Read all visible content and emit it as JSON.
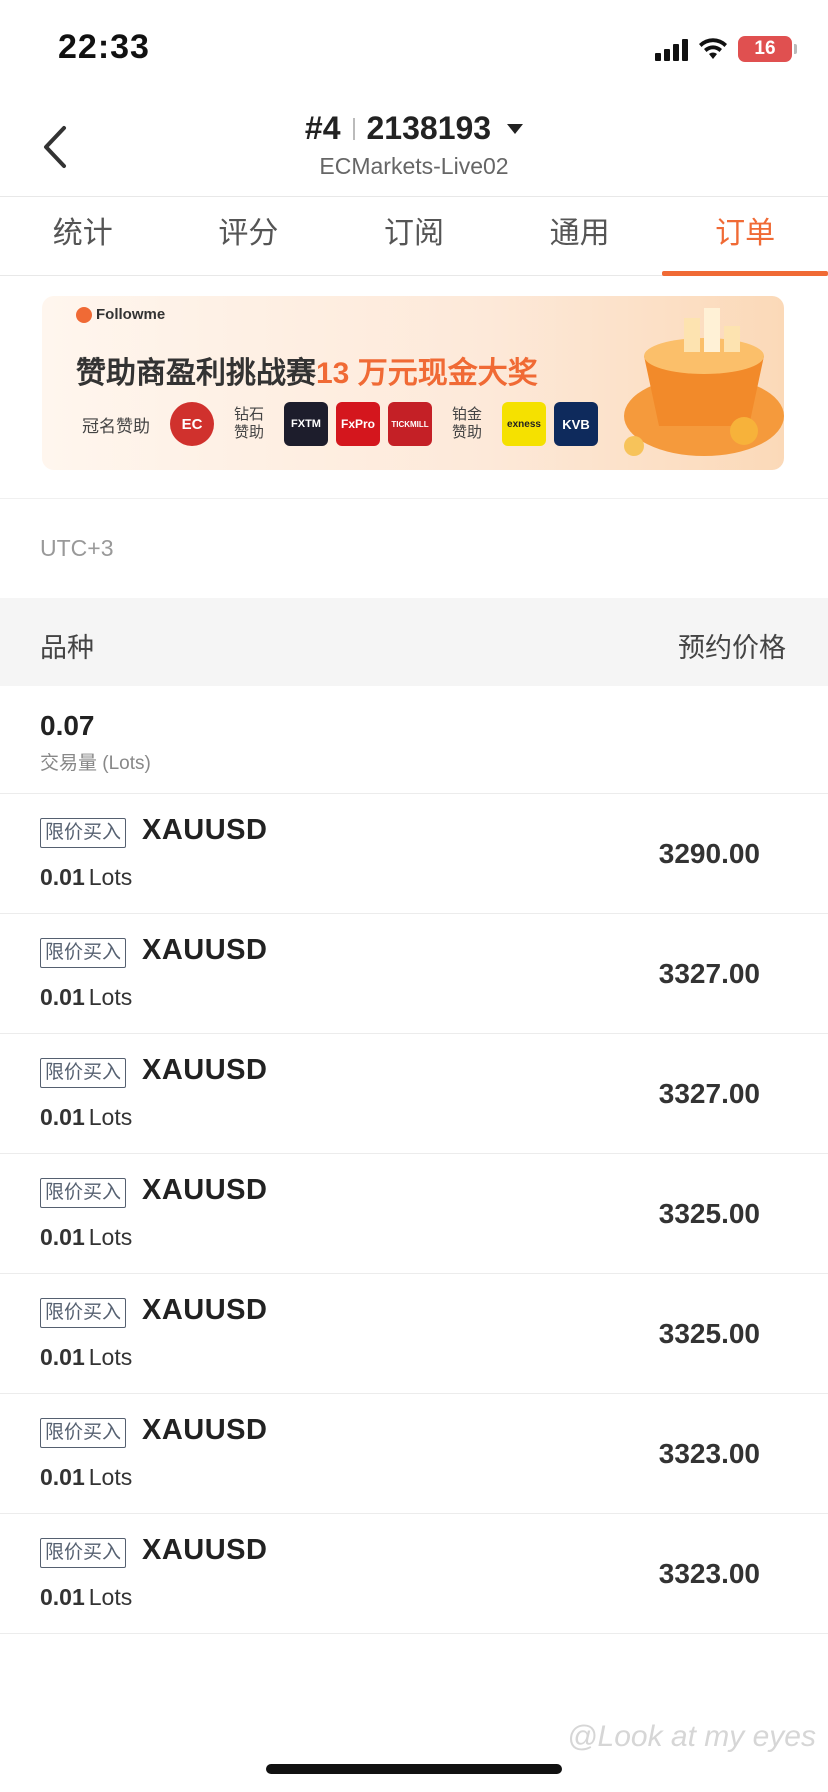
{
  "status_bar": {
    "time": "22:33",
    "battery": "16"
  },
  "header": {
    "account_prefix": "#4",
    "account_number": "2138193",
    "server": "ECMarkets-Live02"
  },
  "tabs": [
    {
      "label": "统计",
      "active": false
    },
    {
      "label": "评分",
      "active": false
    },
    {
      "label": "订阅",
      "active": false
    },
    {
      "label": "通用",
      "active": false
    },
    {
      "label": "订单",
      "active": true
    }
  ],
  "banner": {
    "brand": "Followme",
    "title_main": "赞助商盈利挑战赛",
    "title_highlight": "13 万元现金大奖",
    "title_sponsor_label": "冠名赞助",
    "diamond_label": "钻石赞助",
    "platinum_label": "铂金赞助",
    "logos": {
      "ec": "EC",
      "fxtm": "FXTM",
      "fxpro": "FxPro",
      "tickmill": "TICKMILL",
      "exness": "exness",
      "kvb": "KVB"
    }
  },
  "timezone": "UTC+3",
  "table": {
    "col_left": "品种",
    "col_right": "预约价格"
  },
  "summary": {
    "value": "0.07",
    "label": "交易量 (Lots)"
  },
  "orders": [
    {
      "type": "限价买入",
      "symbol": "XAUUSD",
      "lots": "0.01",
      "unit": "Lots",
      "price": "3290.00"
    },
    {
      "type": "限价买入",
      "symbol": "XAUUSD",
      "lots": "0.01",
      "unit": "Lots",
      "price": "3327.00"
    },
    {
      "type": "限价买入",
      "symbol": "XAUUSD",
      "lots": "0.01",
      "unit": "Lots",
      "price": "3327.00"
    },
    {
      "type": "限价买入",
      "symbol": "XAUUSD",
      "lots": "0.01",
      "unit": "Lots",
      "price": "3325.00"
    },
    {
      "type": "限价买入",
      "symbol": "XAUUSD",
      "lots": "0.01",
      "unit": "Lots",
      "price": "3325.00"
    },
    {
      "type": "限价买入",
      "symbol": "XAUUSD",
      "lots": "0.01",
      "unit": "Lots",
      "price": "3323.00"
    },
    {
      "type": "限价买入",
      "symbol": "XAUUSD",
      "lots": "0.01",
      "unit": "Lots",
      "price": "3323.00"
    }
  ],
  "watermark": "@Look at my eyes",
  "colors": {
    "accent": "#f06a35",
    "tag": "#556070"
  }
}
